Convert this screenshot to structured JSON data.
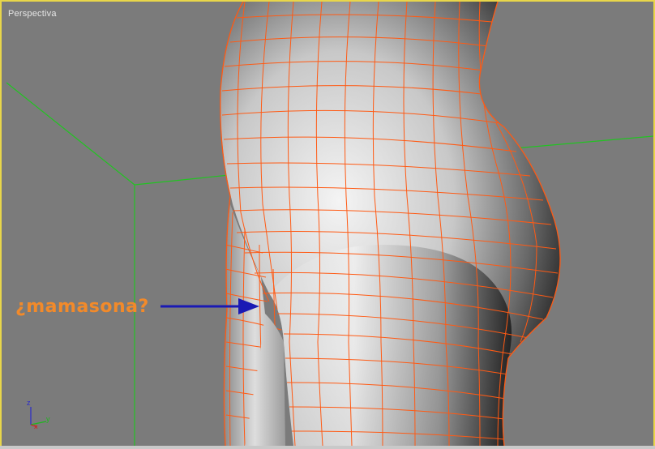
{
  "viewport": {
    "label": "Perspectiva"
  },
  "annotation": {
    "text": "¿mamasona?"
  },
  "axis_gizmo": {
    "z_label": "z",
    "x_label": "x",
    "y_label": "y"
  },
  "colors": {
    "viewport_border": "#e8d64a",
    "viewport_bg": "#7b7b7b",
    "grid_lines": "#22c322",
    "wireframe": "#ff5a14",
    "annotation_text": "#f28a2a",
    "arrow": "#1a1ab4"
  }
}
